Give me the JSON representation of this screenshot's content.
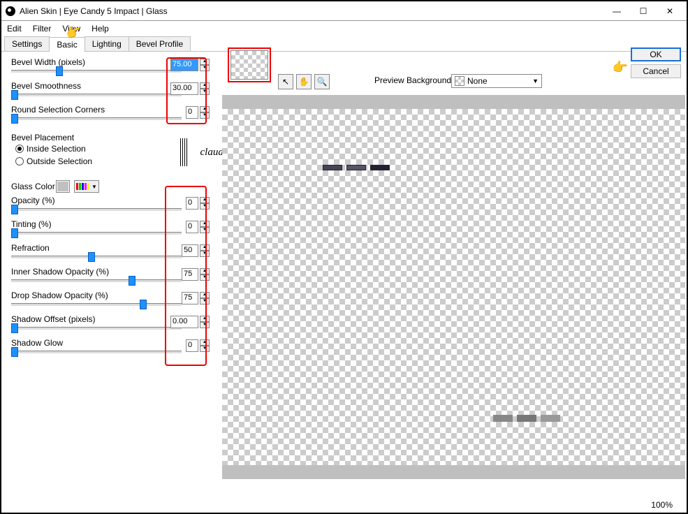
{
  "window": {
    "title": "Alien Skin | Eye Candy 5 Impact | Glass"
  },
  "menu": {
    "edit": "Edit",
    "filter": "Filter",
    "view": "View",
    "help": "Help"
  },
  "tabs": {
    "settings": "Settings",
    "basic": "Basic",
    "lighting": "Lighting",
    "bevel": "Bevel Profile"
  },
  "buttons": {
    "ok": "OK",
    "cancel": "Cancel"
  },
  "preview": {
    "label": "Preview Background:",
    "value": "None"
  },
  "zoom": "100%",
  "fields": {
    "bevel_width": {
      "label": "Bevel Width (pixels)",
      "value": "75.00",
      "slider": 0.28
    },
    "bevel_smooth": {
      "label": "Bevel Smoothness",
      "value": "30.00",
      "slider": 0.01
    },
    "round_corners": {
      "label": "Round Selection Corners",
      "value": "0",
      "slider": 0.01
    },
    "placement_label": "Bevel Placement",
    "inside": "Inside Selection",
    "outside": "Outside Selection",
    "glass_color": "Glass Color",
    "opacity": {
      "label": "Opacity (%)",
      "value": "0",
      "slider": 0.01
    },
    "tinting": {
      "label": "Tinting (%)",
      "value": "0",
      "slider": 0.01
    },
    "refraction": {
      "label": "Refraction",
      "value": "50",
      "slider": 0.48
    },
    "inner_shadow": {
      "label": "Inner Shadow Opacity (%)",
      "value": "75",
      "slider": 0.72
    },
    "drop_shadow": {
      "label": "Drop Shadow Opacity (%)",
      "value": "75",
      "slider": 0.78
    },
    "shadow_offset": {
      "label": "Shadow Offset (pixels)",
      "value": "0.00",
      "slider": 0.01
    },
    "shadow_glow": {
      "label": "Shadow Glow",
      "value": "0",
      "slider": 0.01
    }
  },
  "watermark": "claudia"
}
